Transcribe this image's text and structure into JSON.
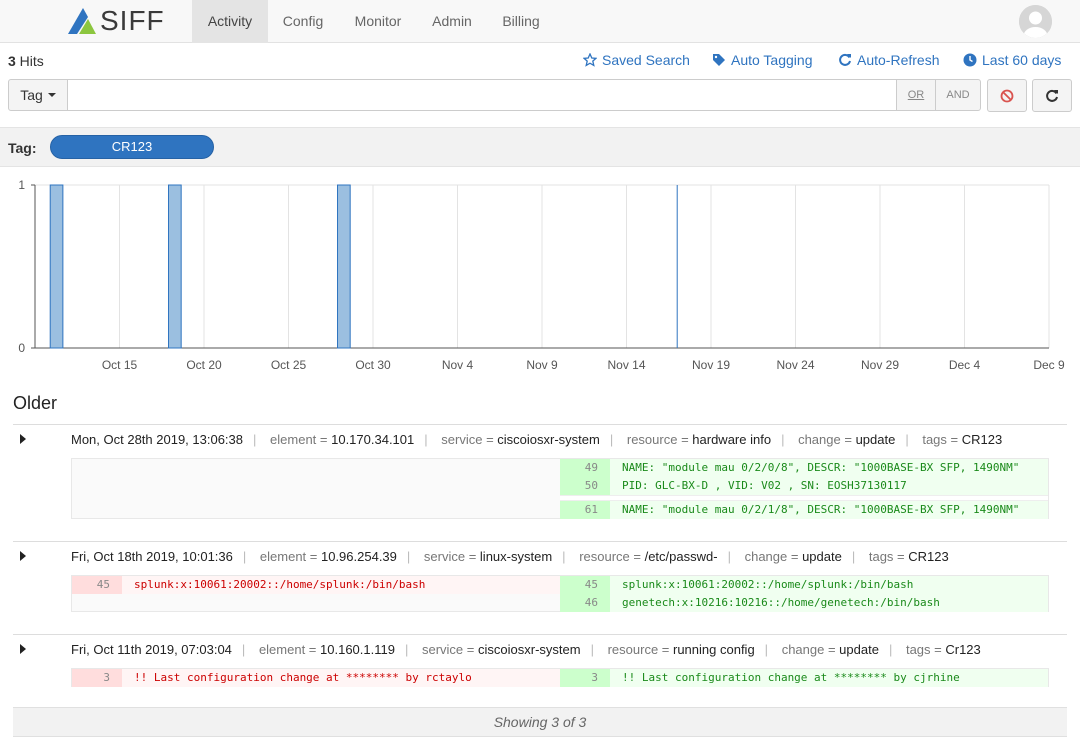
{
  "brand": {
    "name": "SIFF",
    "logo_icon": "siff-logo-icon",
    "colors": {
      "blue": "#2f74c0",
      "green": "#8cc63f"
    }
  },
  "nav": {
    "tabs": [
      {
        "label": "Activity",
        "active": true
      },
      {
        "label": "Config"
      },
      {
        "label": "Monitor"
      },
      {
        "label": "Admin"
      },
      {
        "label": "Billing"
      }
    ],
    "avatar_icon": "user-avatar-icon"
  },
  "search": {
    "hits_count": "3",
    "hits_label": " Hits",
    "actions": {
      "saved_search": "Saved Search",
      "auto_tagging": "Auto Tagging",
      "auto_refresh": "Auto-Refresh",
      "date_range": "Last 60 days"
    },
    "field_selector": "Tag",
    "query_value": "",
    "query_placeholder": "",
    "or_label": "OR",
    "and_label": "AND"
  },
  "tag_filter": {
    "label": "Tag:",
    "value": "CR123"
  },
  "chart_data": {
    "type": "bar",
    "x_ticks": [
      "Oct 15",
      "Oct 20",
      "Oct 25",
      "Oct 30",
      "Nov 4",
      "Nov 9",
      "Nov 14",
      "Nov 19",
      "Nov 24",
      "Nov 29",
      "Dec 4",
      "Dec 9"
    ],
    "x_range": [
      "Oct 10",
      "Dec 9"
    ],
    "y_ticks": [
      "1",
      "0"
    ],
    "ylim": [
      0,
      1
    ],
    "bars": [
      {
        "date": "Oct 11",
        "value": 1
      },
      {
        "date": "Oct 18",
        "value": 1
      },
      {
        "date": "Oct 28",
        "value": 1
      }
    ],
    "marker_date": "Nov 17",
    "grid": true,
    "bar_color": "#9bbfe0"
  },
  "feed": {
    "section_title": "Older",
    "entries": [
      {
        "date": "Mon, Oct 28th 2019, 13:06:38",
        "element": "10.170.34.101",
        "service": "ciscoiosxr-system",
        "resource": "hardware info",
        "change": "update",
        "tags": "CR123",
        "diff": {
          "removed": [],
          "added": [
            {
              "line": "49",
              "text": "NAME: \"module mau 0/2/0/8\", DESCR: \"1000BASE-BX SFP, 1490NM\""
            },
            {
              "line": "50",
              "text": "PID: GLC-BX-D            , VID: V02 , SN: EOSH37130117"
            },
            {
              "line": "61",
              "text": "NAME: \"module mau 0/2/1/8\", DESCR: \"1000BASE-BX SFP, 1490NM\""
            }
          ]
        }
      },
      {
        "date": "Fri, Oct 18th 2019, 10:01:36",
        "element": "10.96.254.39",
        "service": "linux-system",
        "resource": "/etc/passwd-",
        "change": "update",
        "tags": "CR123",
        "diff": {
          "removed": [
            {
              "line": "45",
              "text": "splunk:x:10061:20002::/home/splunk:/bin/bash"
            }
          ],
          "added": [
            {
              "line": "45",
              "text": "splunk:x:10061:20002::/home/splunk:/bin/bash"
            },
            {
              "line": "46",
              "text": "genetech:x:10216:10216::/home/genetech:/bin/bash"
            }
          ]
        }
      },
      {
        "date": "Fri, Oct 11th 2019, 07:03:04",
        "element": "10.160.1.119",
        "service": "ciscoiosxr-system",
        "resource": "running config",
        "change": "update",
        "tags": "Cr123",
        "diff": {
          "removed": [
            {
              "line": "3",
              "text": "!! Last configuration change at ******** by rctaylo"
            }
          ],
          "added": [
            {
              "line": "3",
              "text": "!! Last configuration change at ******** by cjrhine"
            }
          ]
        }
      }
    ],
    "meta_keys": {
      "element": "element",
      "service": "service",
      "resource": "resource",
      "change": "change",
      "tags": "tags"
    },
    "footer": "Showing 3 of 3"
  }
}
